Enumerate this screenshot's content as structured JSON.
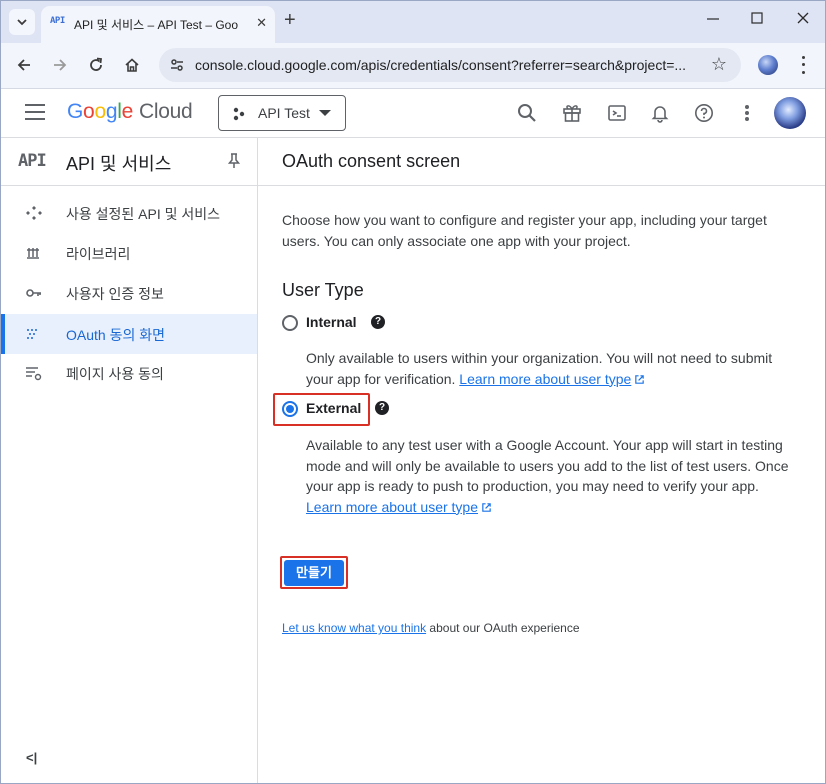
{
  "browser": {
    "tab_title": "API 및 서비스 – API Test – Goo",
    "tab_favicon_text": "API",
    "url": "console.cloud.google.com/apis/credentials/consent?referrer=search&project=...",
    "icons": [
      "tab-menu-icon",
      "close-icon",
      "new-tab-icon",
      "minimize-icon",
      "maximize-icon",
      "window-close-icon",
      "back-icon",
      "forward-icon",
      "reload-icon",
      "home-icon",
      "site-info-icon",
      "bookmark-star-icon",
      "profile-icon",
      "menu-kebab-icon"
    ]
  },
  "header": {
    "logo_google": [
      "G",
      "o",
      "o",
      "g",
      "l",
      "e"
    ],
    "logo_cloud": "Cloud",
    "project": "API Test",
    "icons": [
      "hamburger-icon",
      "search-icon",
      "gift-icon",
      "cloud-shell-icon",
      "notifications-bell-icon",
      "help-icon",
      "settings-kebab-icon",
      "account-avatar"
    ]
  },
  "sidebar": {
    "icon_text": "API",
    "title": "API 및 서비스",
    "items": [
      {
        "label": "사용 설정된 API 및 서비스",
        "icon": "apis-diamond-icon",
        "active": false
      },
      {
        "label": "라이브러리",
        "icon": "library-icon",
        "active": false
      },
      {
        "label": "사용자 인증 정보",
        "icon": "key-icon",
        "active": false
      },
      {
        "label": "OAuth 동의 화면",
        "icon": "oauth-dots-icon",
        "active": true
      },
      {
        "label": "페이지 사용 동의",
        "icon": "page-usage-icon",
        "active": false
      }
    ],
    "collapse_label": "<|"
  },
  "main": {
    "title": "OAuth consent screen",
    "intro": "Choose how you want to configure and register your app, including your target users. You can only associate one app with your project.",
    "user_type_heading": "User Type",
    "options": [
      {
        "label": "Internal",
        "selected": false,
        "desc": "Only available to users within your organization. You will not need to submit your app for verification. ",
        "link": "Learn more about user type"
      },
      {
        "label": "External",
        "selected": true,
        "desc": "Available to any test user with a Google Account. Your app will start in testing mode and will only be available to users you add to the list of test users. Once your app is ready to push to production, you may need to verify your app. ",
        "link": "Learn more about user type"
      }
    ],
    "create_button": "만들기",
    "feedback_link": "Let us know what you think",
    "feedback_text": " about our OAuth experience"
  },
  "colors": {
    "accent": "#1a73e8",
    "highlight": "#d93025",
    "sidebar_active_bg": "#e8f0fe"
  }
}
